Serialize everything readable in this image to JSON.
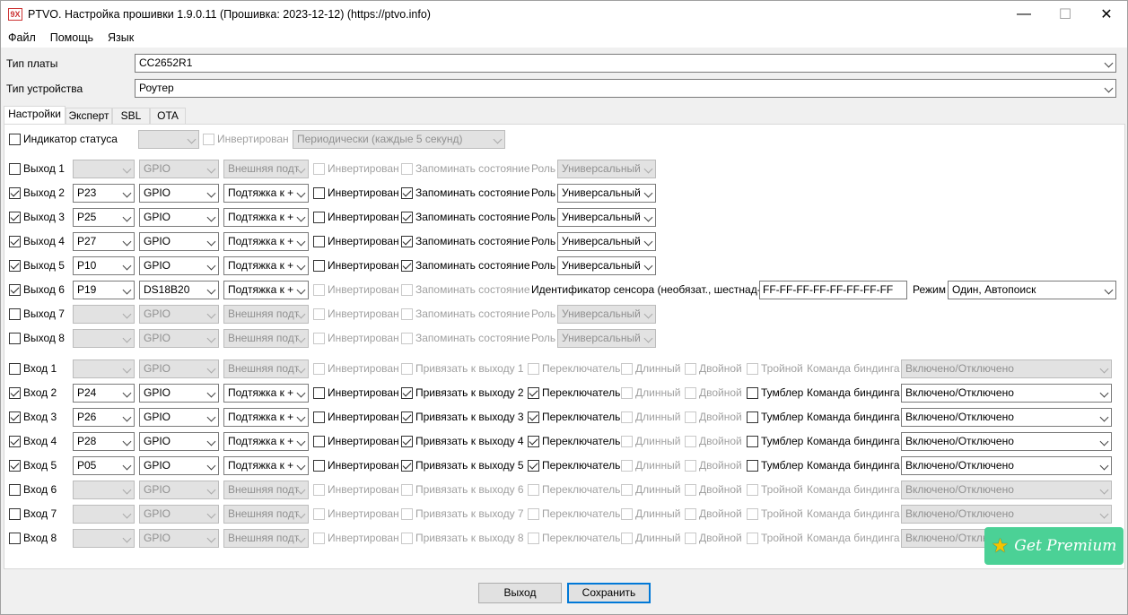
{
  "title": "PTVO. Настройка прошивки 1.9.0.11 (Прошивка: 2023-12-12) (https://ptvo.info)",
  "app_icon": "9X",
  "window_controls": {
    "minimize": "—",
    "maximize": "☐",
    "close": "✕"
  },
  "menu": [
    "Файл",
    "Помощь",
    "Язык"
  ],
  "board": {
    "label": "Тип платы",
    "value": "CC2652R1"
  },
  "device": {
    "label": "Тип устройства",
    "value": "Роутер"
  },
  "tabs": [
    "Настройки",
    "Эксперт",
    "SBL",
    "OTA"
  ],
  "status": {
    "label": "Индикатор статуса",
    "checked": false,
    "pin": "",
    "inverted_label": "Инвертирован",
    "mode": "Периодически (каждые 5 секунд)"
  },
  "common": {
    "inverted": "Инвертирован",
    "remember": "Запоминать состояние",
    "role": "Роль",
    "role_value": "Универсальный",
    "bind_cmd": "Команда биндинга",
    "bind_value": "Включено/Отключено",
    "switch": "Переключатель",
    "long": "Длинный",
    "double": "Двойной",
    "triple": "Тройной",
    "toggle": "Тумблер",
    "sensor_id_label": "Идентификатор сенсора (необязат., шестнад-ый)",
    "sensor_id": "FF-FF-FF-FF-FF-FF-FF-FF",
    "mode_label": "Режим",
    "mode_value": "Один, Автопоиск"
  },
  "outputs": [
    {
      "label": "Выход 1",
      "checked": false,
      "pin": "",
      "type": "GPIO",
      "pull": "Внешняя подт",
      "inv": false,
      "remember": false
    },
    {
      "label": "Выход 2",
      "checked": true,
      "pin": "P23",
      "type": "GPIO",
      "pull": "Подтяжка к +",
      "inv": false,
      "remember": true
    },
    {
      "label": "Выход 3",
      "checked": true,
      "pin": "P25",
      "type": "GPIO",
      "pull": "Подтяжка к +",
      "inv": false,
      "remember": true
    },
    {
      "label": "Выход 4",
      "checked": true,
      "pin": "P27",
      "type": "GPIO",
      "pull": "Подтяжка к +",
      "inv": false,
      "remember": true
    },
    {
      "label": "Выход 5",
      "checked": true,
      "pin": "P10",
      "type": "GPIO",
      "pull": "Подтяжка к +",
      "inv": false,
      "remember": true
    },
    {
      "label": "Выход 6",
      "checked": true,
      "pin": "P19",
      "type": "DS18B20",
      "pull": "Подтяжка к +",
      "inv": false,
      "remember": false
    },
    {
      "label": "Выход 7",
      "checked": false,
      "pin": "",
      "type": "GPIO",
      "pull": "Внешняя подт",
      "inv": false,
      "remember": false
    },
    {
      "label": "Выход 8",
      "checked": false,
      "pin": "",
      "type": "GPIO",
      "pull": "Внешняя подт",
      "inv": false,
      "remember": false
    }
  ],
  "inputs": [
    {
      "label": "Вход 1",
      "checked": false,
      "pin": "",
      "type": "GPIO",
      "pull": "Внешняя подт",
      "bind": "Привязать к выходу 1",
      "bind_on": false,
      "sw": false
    },
    {
      "label": "Вход 2",
      "checked": true,
      "pin": "P24",
      "type": "GPIO",
      "pull": "Подтяжка к +",
      "bind": "Привязать к выходу 2",
      "bind_on": true,
      "sw": true
    },
    {
      "label": "Вход 3",
      "checked": true,
      "pin": "P26",
      "type": "GPIO",
      "pull": "Подтяжка к +",
      "bind": "Привязать к выходу 3",
      "bind_on": true,
      "sw": true
    },
    {
      "label": "Вход 4",
      "checked": true,
      "pin": "P28",
      "type": "GPIO",
      "pull": "Подтяжка к +",
      "bind": "Привязать к выходу 4",
      "bind_on": true,
      "sw": true
    },
    {
      "label": "Вход 5",
      "checked": true,
      "pin": "P05",
      "type": "GPIO",
      "pull": "Подтяжка к +",
      "bind": "Привязать к выходу 5",
      "bind_on": true,
      "sw": true
    },
    {
      "label": "Вход 6",
      "checked": false,
      "pin": "",
      "type": "GPIO",
      "pull": "Внешняя подт",
      "bind": "Привязать к выходу 6",
      "bind_on": false,
      "sw": false
    },
    {
      "label": "Вход 7",
      "checked": false,
      "pin": "",
      "type": "GPIO",
      "pull": "Внешняя подт",
      "bind": "Привязать к выходу 7",
      "bind_on": false,
      "sw": false
    },
    {
      "label": "Вход 8",
      "checked": false,
      "pin": "",
      "type": "GPIO",
      "pull": "Внешняя подт",
      "bind": "Привязать к выходу 8",
      "bind_on": false,
      "sw": false
    }
  ],
  "buttons": {
    "exit": "Выход",
    "save": "Сохранить"
  },
  "premium": {
    "label": "Get Premium",
    "icon": "star-icon"
  }
}
